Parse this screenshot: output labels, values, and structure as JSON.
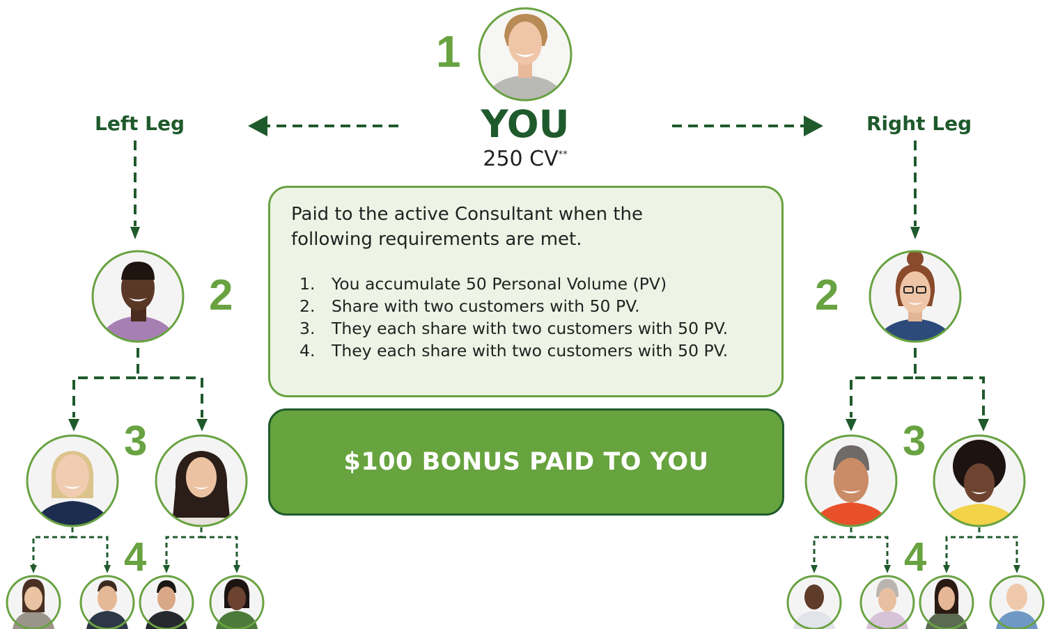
{
  "you": {
    "level": "1",
    "title": "YOU",
    "cv_value": "250 CV",
    "cv_mark": "**"
  },
  "left_leg": {
    "label": "Left Leg",
    "level2": "2",
    "level3": "3",
    "level4": "4"
  },
  "right_leg": {
    "label": "Right Leg",
    "level2": "2",
    "level3": "3",
    "level4": "4"
  },
  "requirements": {
    "intro": "Paid to the active Consultant when the following requirements are met.",
    "items": [
      {
        "num": "1.",
        "text": "You accumulate 50 Personal Volume (PV)"
      },
      {
        "num": "2.",
        "text": "Share with two customers with 50 PV."
      },
      {
        "num": "3.",
        "text": "They each share with two customers with 50 PV."
      },
      {
        "num": "4.",
        "text": "They each share with two customers with 50 PV."
      }
    ]
  },
  "bonus": {
    "label": "$100 BONUS PAID TO YOU"
  },
  "colors": {
    "dark_green": "#1f5a2c",
    "accent_green": "#68a241",
    "box_fill": "#edf4e5",
    "bonus_fill": "#67a33e"
  }
}
